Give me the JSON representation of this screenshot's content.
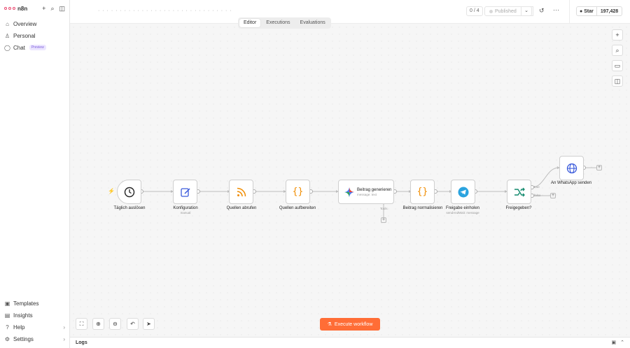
{
  "app": {
    "name": "n8n"
  },
  "sidebar": {
    "top": [
      {
        "label": "Overview",
        "icon": "home-icon"
      },
      {
        "label": "Personal",
        "icon": "user-icon"
      },
      {
        "label": "Chat",
        "icon": "chat-icon",
        "badge": "Preview"
      }
    ],
    "bottom": [
      {
        "label": "Templates",
        "icon": "templates-icon"
      },
      {
        "label": "Insights",
        "icon": "insights-icon"
      },
      {
        "label": "Help",
        "icon": "help-icon"
      },
      {
        "label": "Settings",
        "icon": "settings-icon"
      }
    ]
  },
  "header": {
    "workflow_name": "· · · · · · · · · · · · · · · · · · · · · · · · ·  · · · ·  ·  ·",
    "counter": "0 / 4",
    "publish_label": "Published",
    "github": {
      "star_label": "Star",
      "count": "197,428"
    },
    "tabs": [
      "Editor",
      "Executions",
      "Evaluations"
    ],
    "active_tab": "Editor"
  },
  "canvas": {
    "nodes": [
      {
        "id": "trigger",
        "title": "Täglich auslösen",
        "icon": "clock-icon"
      },
      {
        "id": "config",
        "title": "Konfiguration",
        "sub": "manual",
        "icon": "edit-icon"
      },
      {
        "id": "rss",
        "title": "Quellen abrufen",
        "icon": "rss-icon"
      },
      {
        "id": "prep",
        "title": "Quellen aufbereiten",
        "icon": "code-icon"
      },
      {
        "id": "gen",
        "title": "Beitrag generieren",
        "sub": "message: text",
        "icon": "gemini-icon",
        "tools_label": "Tools"
      },
      {
        "id": "norm",
        "title": "Beitrag normalisieren",
        "icon": "code-icon"
      },
      {
        "id": "approve",
        "title": "Freigabe einholen",
        "sub": "sendAndWait: message",
        "icon": "telegram-icon"
      },
      {
        "id": "if",
        "title": "Freigegeben?",
        "icon": "branch-icon",
        "true_label": "true",
        "false_label": "false"
      },
      {
        "id": "whatsapp",
        "title": "An WhatsApp senden",
        "icon": "globe-icon"
      }
    ],
    "execute_label": "Execute workflow"
  },
  "logs": {
    "label": "Logs"
  },
  "colors": {
    "accent": "#ff6d36",
    "brand": "#ea4b71"
  }
}
